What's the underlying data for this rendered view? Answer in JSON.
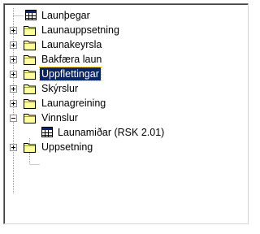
{
  "tree": {
    "items": [
      {
        "label": "Launþegar",
        "icon": "table-icon",
        "state": "leaf"
      },
      {
        "label": "Launauppsetning",
        "icon": "folder-icon",
        "state": "collapsed"
      },
      {
        "label": "Launakeyrsla",
        "icon": "folder-icon",
        "state": "collapsed"
      },
      {
        "label": "Bakfæra laun",
        "icon": "folder-icon",
        "state": "collapsed"
      },
      {
        "label": "Uppflettingar",
        "icon": "folder-icon",
        "state": "collapsed",
        "selected": true
      },
      {
        "label": "Skýrslur",
        "icon": "folder-icon",
        "state": "collapsed"
      },
      {
        "label": "Launagreining",
        "icon": "folder-icon",
        "state": "collapsed"
      },
      {
        "label": "Vinnslur",
        "icon": "folder-icon",
        "state": "expanded"
      },
      {
        "label": "Launamiðar (RSK 2.01)",
        "icon": "table-icon",
        "state": "leaf"
      },
      {
        "label": "Uppsetning",
        "icon": "folder-icon",
        "state": "collapsed"
      }
    ]
  },
  "colors": {
    "selection": "#0a246a",
    "folder": "#ffff9c",
    "table_header": "#0a246a"
  }
}
